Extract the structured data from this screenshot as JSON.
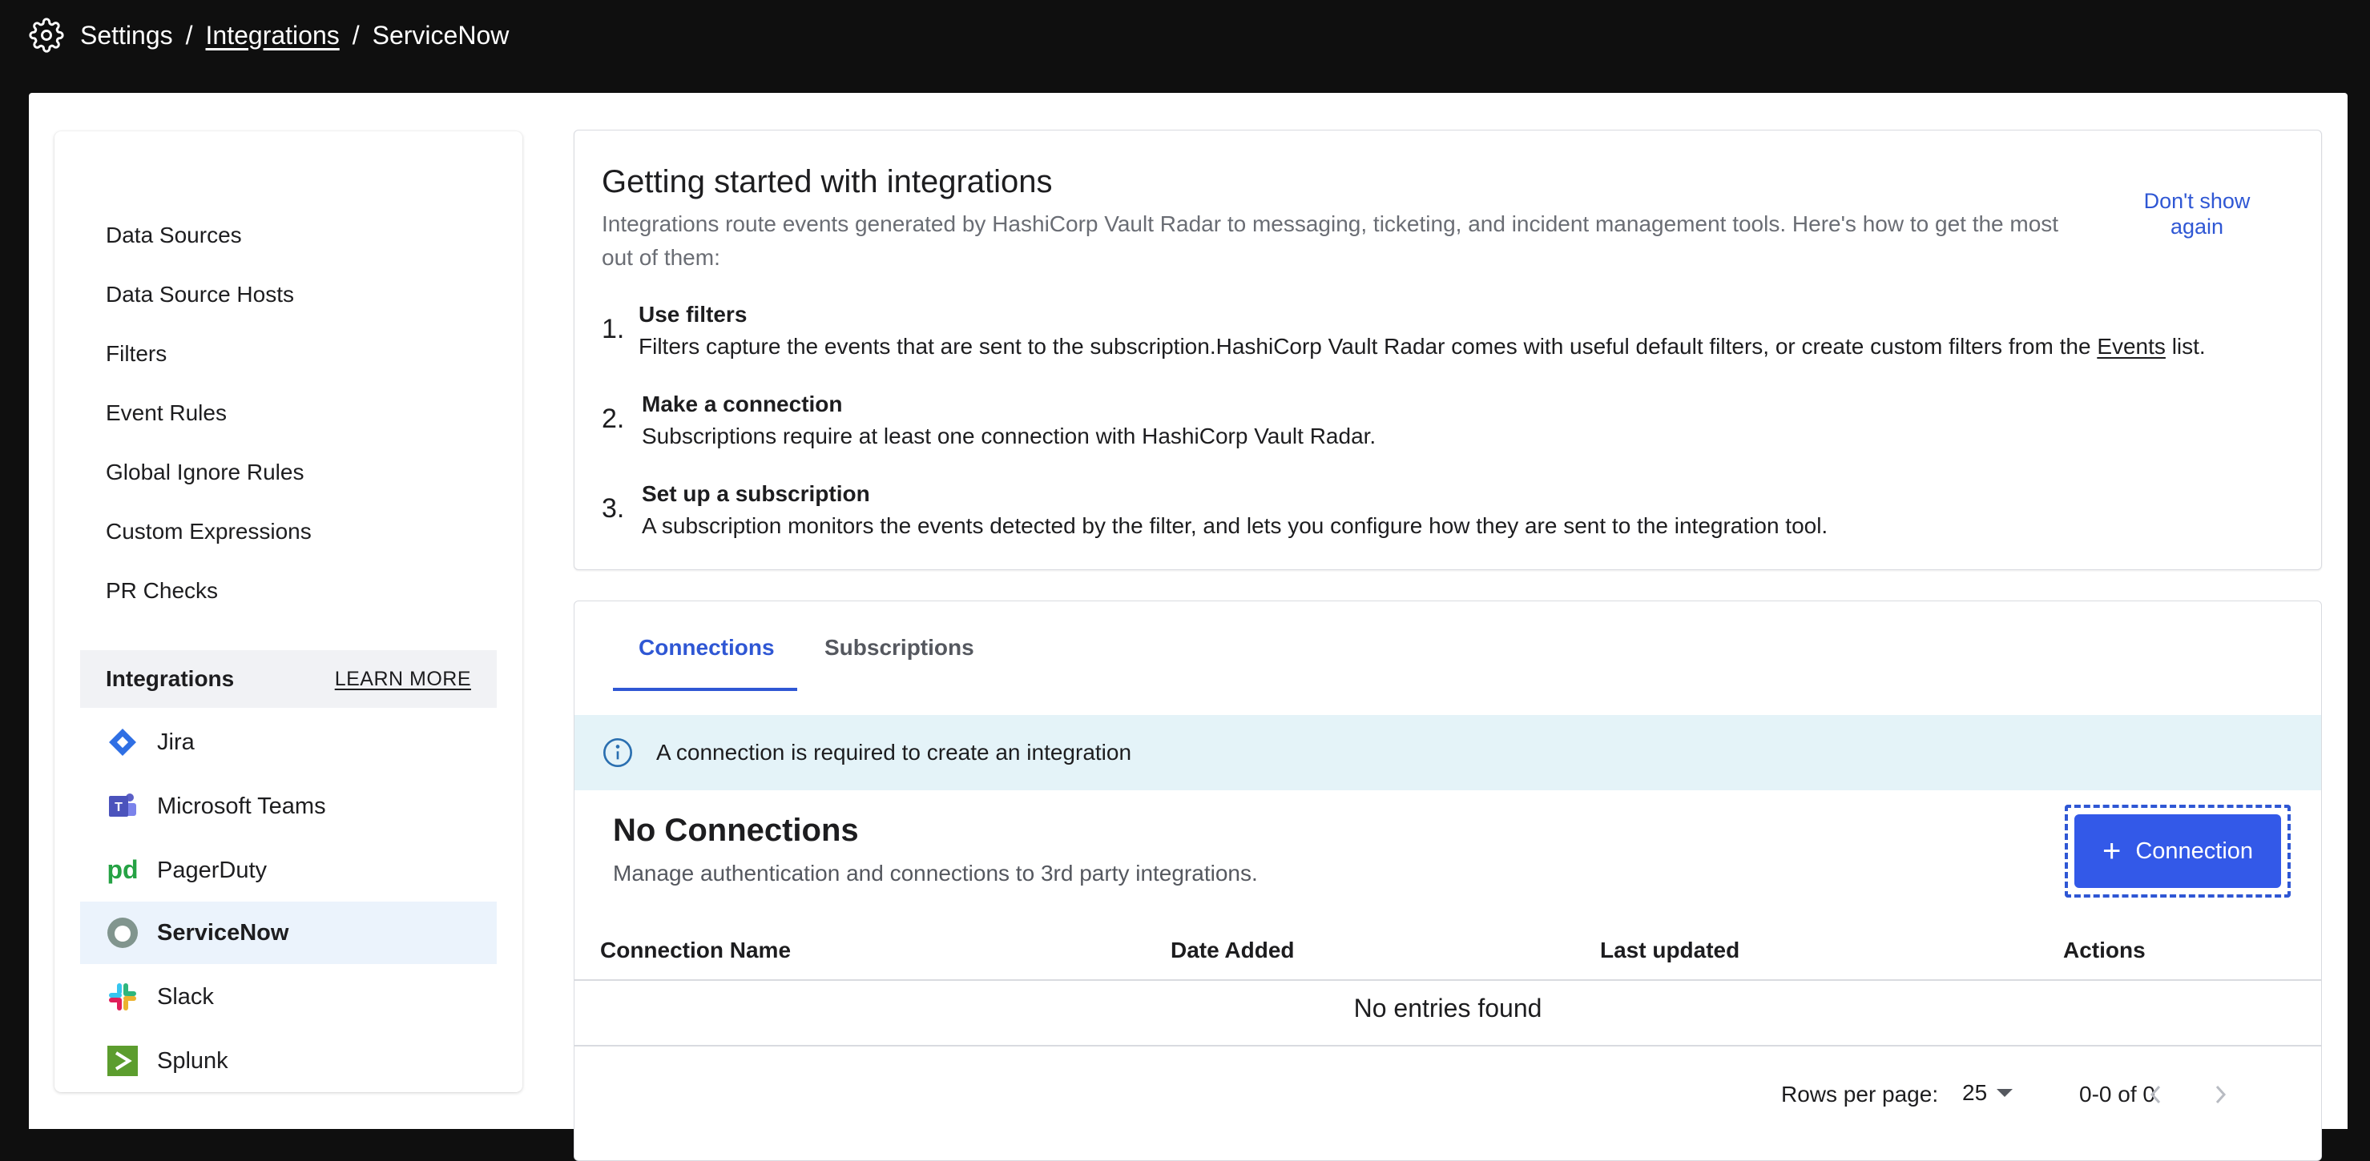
{
  "breadcrumb": {
    "root": "Settings",
    "separator": "/",
    "middle": "Integrations",
    "current": "ServiceNow"
  },
  "sidebar": {
    "items": [
      {
        "label": "Data Sources"
      },
      {
        "label": "Data Source Hosts"
      },
      {
        "label": "Filters"
      },
      {
        "label": "Event Rules"
      },
      {
        "label": "Global Ignore Rules"
      },
      {
        "label": "Custom Expressions"
      },
      {
        "label": "PR Checks"
      }
    ],
    "integrations_header": "Integrations",
    "learn_more": "LEARN MORE",
    "integrations": [
      {
        "label": "Jira",
        "icon": "jira-icon"
      },
      {
        "label": "Microsoft Teams",
        "icon": "microsoft-teams-icon"
      },
      {
        "label": "PagerDuty",
        "icon": "pagerduty-icon"
      },
      {
        "label": "ServiceNow",
        "icon": "servicenow-icon",
        "active": true
      },
      {
        "label": "Slack",
        "icon": "slack-icon"
      },
      {
        "label": "Splunk",
        "icon": "splunk-icon"
      }
    ]
  },
  "getting_started": {
    "title": "Getting started with integrations",
    "description": "Integrations route events generated by HashiCorp Vault Radar to messaging, ticketing, and incident management tools. Here's how to get the most out of them:",
    "dont_show": "Don't show again",
    "steps": [
      {
        "num": "1.",
        "title": "Use filters",
        "body_before": "Filters capture the events that are sent to the subscription.HashiCorp Vault Radar comes with useful default filters, or create custom filters from the ",
        "link": "Events",
        "body_after": " list."
      },
      {
        "num": "2.",
        "title": "Make a connection",
        "body": "Subscriptions require at least one connection with HashiCorp Vault Radar."
      },
      {
        "num": "3.",
        "title": "Set up a subscription",
        "body": "A subscription monitors the events detected by the filter, and lets you configure how they are sent to the integration tool."
      }
    ]
  },
  "connections": {
    "tabs": [
      "Connections",
      "Subscriptions"
    ],
    "alert": "A connection is required to create an integration",
    "empty_title": "No Connections",
    "empty_desc": "Manage authentication and connections to 3rd party integrations.",
    "add_button": "Connection",
    "columns": [
      "Connection Name",
      "Date Added",
      "Last updated",
      "Actions"
    ],
    "no_entries": "No entries found",
    "rows_per_page_label": "Rows per page:",
    "rows_per_page": "25",
    "range": "0-0 of 0"
  },
  "colors": {
    "accent": "#2f57d4",
    "button": "#3359e8",
    "alert_bg": "#e4f3f8",
    "active_bg": "#ebf3fc",
    "topbar": "#0f0f0f"
  }
}
